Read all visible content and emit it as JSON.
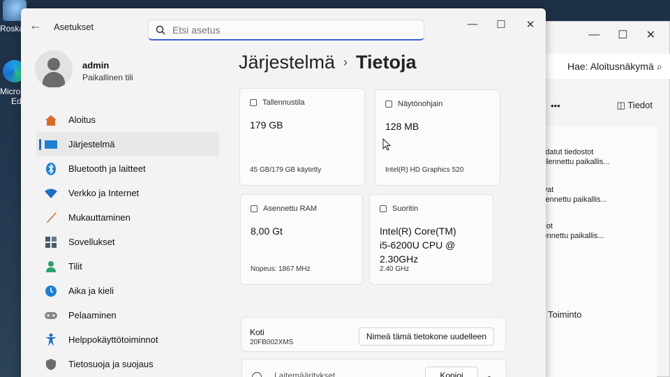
{
  "desktop": {
    "recycle_label": "Roska",
    "edge_label_line1": "Micros",
    "edge_label_line2": "Edg"
  },
  "explorer": {
    "search_text": "Hae: Aloitusnäkymä",
    "more_label": "•••",
    "details_label": "Tiedot",
    "quick_access": [
      {
        "title": "Ladatut tiedostot",
        "sub": "Tallennettu paikallis..."
      },
      {
        "title": "Kuvat",
        "sub": "Tallennettu paikallis..."
      },
      {
        "title": "Videot",
        "sub": "Tallennettu paikallis..."
      }
    ],
    "footer_label": "Toiminto"
  },
  "window": {
    "title": "Asetukset",
    "search_placeholder": "Etsi asetus"
  },
  "profile": {
    "name": "admin",
    "account_type": "Paikallinen tili"
  },
  "nav": [
    {
      "label": "Aloitus",
      "icon": "home-icon",
      "color": "#d86a2b"
    },
    {
      "label": "Järjestelmä",
      "icon": "monitor-icon",
      "color": "#1d7fd1",
      "active": true
    },
    {
      "label": "Bluetooth ja laitteet",
      "icon": "bluetooth-icon",
      "color": "#1d7fd1"
    },
    {
      "label": "Verkko ja Internet",
      "icon": "wifi-icon",
      "color": "#1d6fc4"
    },
    {
      "label": "Mukauttaminen",
      "icon": "brush-icon",
      "color": "#c86a2b"
    },
    {
      "label": "Sovellukset",
      "icon": "apps-icon",
      "color": "#4a5a6a"
    },
    {
      "label": "Tilit",
      "icon": "person-icon",
      "color": "#2aa36a"
    },
    {
      "label": "Aika ja kieli",
      "icon": "clock-globe-icon",
      "color": "#1d7fd1"
    },
    {
      "label": "Pelaaminen",
      "icon": "gamepad-icon",
      "color": "#777777"
    },
    {
      "label": "Helppokäyttötoiminnot",
      "icon": "accessibility-icon",
      "color": "#1d6fc4"
    },
    {
      "label": "Tietosuoja ja suojaus",
      "icon": "shield-icon",
      "color": "#6b6b6b"
    }
  ],
  "breadcrumb": {
    "parent": "Järjestelmä",
    "separator": "›",
    "current": "Tietoja"
  },
  "cards": {
    "storage": {
      "title": "Tallennustila",
      "value": "179 GB",
      "footer": "45 GB/179 GB käytetty"
    },
    "gpu": {
      "title": "Näytönohjain",
      "value": "128 MB",
      "footer": "Intel(R) HD Graphics 520"
    },
    "ram": {
      "title": "Asennettu RAM",
      "value": "8,00 Gt",
      "footer": "Nopeus: 1867 MHz"
    },
    "cpu": {
      "title": "Suoritin",
      "value_line1": "Intel(R) Core(TM)",
      "value_line2": "i5-6200U CPU @",
      "value_line3": "2.30GHz",
      "footer": "2.40 GHz"
    }
  },
  "device": {
    "name": "Koti",
    "model": "20FB002XMS",
    "rename_label": "Nimeä tämä tietokone uudelleen"
  },
  "specs": {
    "title": "Laitemääritykset",
    "copy_label": "Kopioi"
  }
}
